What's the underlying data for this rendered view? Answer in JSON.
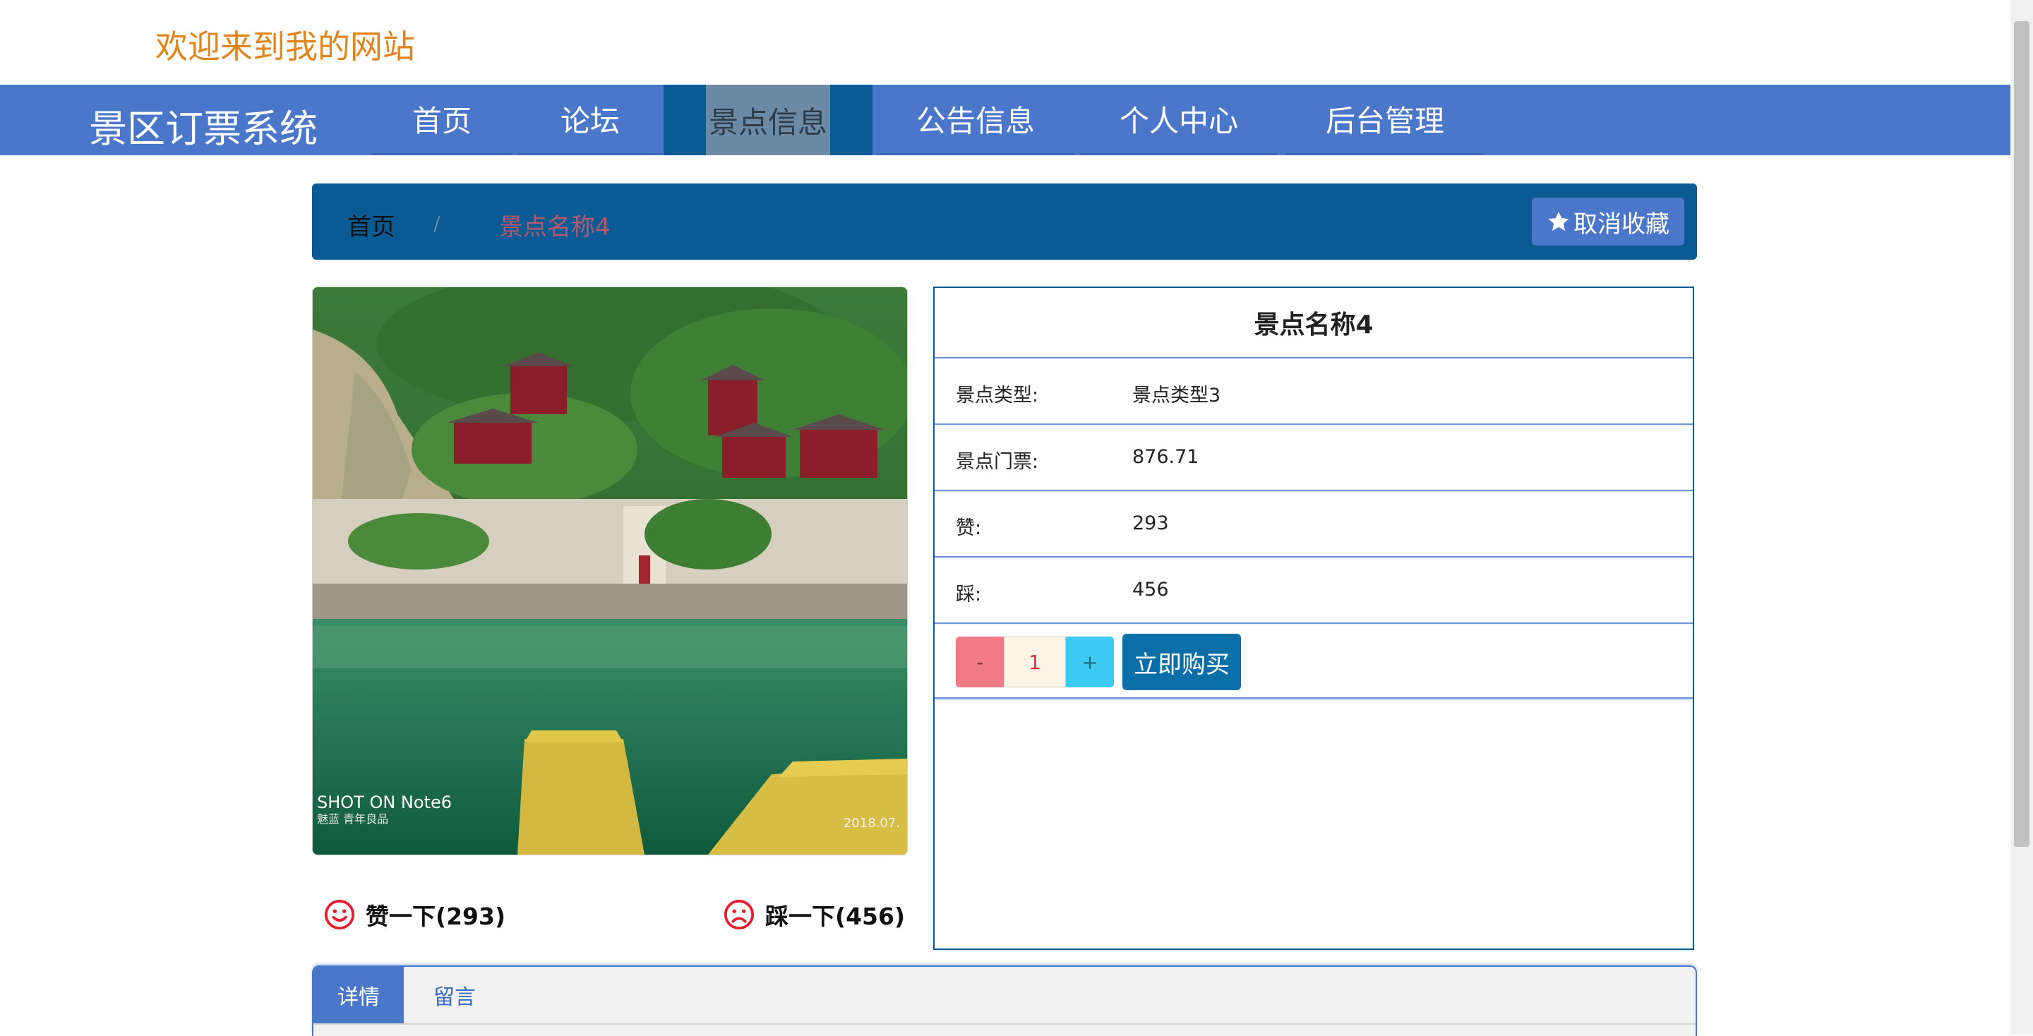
{
  "header": {
    "welcome": "欢迎来到我的网站"
  },
  "nav": {
    "brand": "景区订票系统",
    "items": [
      {
        "label": "首页"
      },
      {
        "label": "论坛"
      },
      {
        "label": "景点信息"
      },
      {
        "label": "公告信息"
      },
      {
        "label": "个人中心"
      },
      {
        "label": "后台管理"
      }
    ],
    "active_index": 2
  },
  "breadcrumb": {
    "home": "首页",
    "separator": "/",
    "current": "景点名称4",
    "favorite_button": "取消收藏",
    "favorite_icon": "star-icon"
  },
  "photo": {
    "caption": "SHOT ON Note6",
    "sub_caption": "魅蓝 青年良品",
    "date": "2018.07."
  },
  "votes": {
    "like_label": "赞一下(293)",
    "dislike_label": "踩一下(456)",
    "like_icon": "smile-icon",
    "dislike_icon": "frown-icon"
  },
  "detail": {
    "title": "景点名称4",
    "rows": [
      {
        "label": "景点类型:",
        "value": "景点类型3"
      },
      {
        "label": "景点门票:",
        "value": "876.71"
      },
      {
        "label": "赞:",
        "value": "293"
      },
      {
        "label": "踩:",
        "value": "456"
      }
    ],
    "quantity": "1",
    "minus_label": "-",
    "plus_label": "+",
    "buy_label": "立即购买"
  },
  "tabs": [
    {
      "label": "详情"
    },
    {
      "label": "留言"
    }
  ],
  "colors": {
    "nav_bg": "#4a77c9",
    "primary_dark": "#0a5a94",
    "welcome": "#e2841c",
    "vote_icon": "#e0202e"
  }
}
